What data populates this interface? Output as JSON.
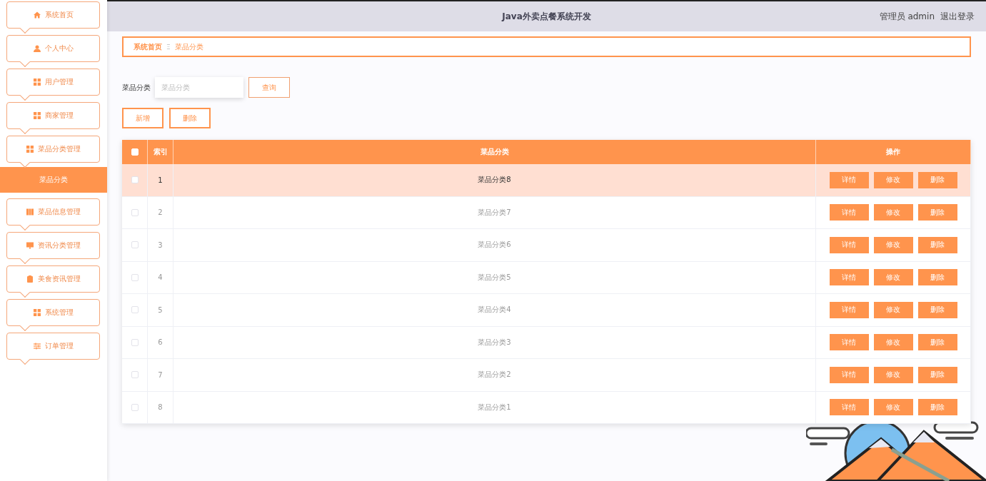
{
  "header": {
    "title": "Java外卖点餐系统开发",
    "user": "管理员 admin",
    "logout": "退出登录"
  },
  "sidebar": {
    "items": [
      {
        "label": "系统首页",
        "kind": "home",
        "selected": false
      },
      {
        "label": "个人中心",
        "kind": "user",
        "selected": false
      },
      {
        "label": "用户管理",
        "kind": "grid",
        "selected": false
      },
      {
        "label": "商家管理",
        "kind": "grid",
        "selected": false
      },
      {
        "label": "菜品分类管理",
        "kind": "grid",
        "selected": false,
        "children": [
          {
            "label": "菜品分类",
            "selected": true
          }
        ]
      },
      {
        "label": "菜品信息管理",
        "kind": "book",
        "selected": false
      },
      {
        "label": "资讯分类管理",
        "kind": "monitor",
        "selected": false
      },
      {
        "label": "美食资讯管理",
        "kind": "clipboard",
        "selected": false
      },
      {
        "label": "系统管理",
        "kind": "grid",
        "selected": false
      },
      {
        "label": "订单管理",
        "kind": "sliders",
        "selected": false
      }
    ]
  },
  "breadcrumb": {
    "items": [
      "系统首页",
      "菜品分类"
    ],
    "separator": "Ξ"
  },
  "search": {
    "label": "菜品分类",
    "placeholder": "菜品分类",
    "button": "查询"
  },
  "actions": [
    "新增",
    "删除"
  ],
  "table": {
    "columns": [
      "索引",
      "菜品分类",
      "操作"
    ],
    "all_checked": false,
    "rows": [
      {
        "index": "1",
        "name": "菜品分类8",
        "checked": false,
        "highlighted": true,
        "buttons": [
          "详情",
          "修改",
          "删除"
        ]
      },
      {
        "index": "2",
        "name": "菜品分类7",
        "checked": false,
        "highlighted": false,
        "buttons": [
          "详情",
          "修改",
          "删除"
        ]
      },
      {
        "index": "3",
        "name": "菜品分类6",
        "checked": false,
        "highlighted": false,
        "buttons": [
          "详情",
          "修改",
          "删除"
        ]
      },
      {
        "index": "4",
        "name": "菜品分类5",
        "checked": false,
        "highlighted": false,
        "buttons": [
          "详情",
          "修改",
          "删除"
        ]
      },
      {
        "index": "5",
        "name": "菜品分类4",
        "checked": false,
        "highlighted": false,
        "buttons": [
          "详情",
          "修改",
          "删除"
        ]
      },
      {
        "index": "6",
        "name": "菜品分类3",
        "checked": false,
        "highlighted": false,
        "buttons": [
          "详情",
          "修改",
          "删除"
        ]
      },
      {
        "index": "7",
        "name": "菜品分类2",
        "checked": false,
        "highlighted": false,
        "buttons": [
          "详情",
          "修改",
          "删除"
        ]
      },
      {
        "index": "8",
        "name": "菜品分类1",
        "checked": false,
        "highlighted": false,
        "buttons": [
          "详情",
          "修改",
          "删除"
        ]
      }
    ]
  },
  "decoration": {
    "kind": "picture"
  }
}
